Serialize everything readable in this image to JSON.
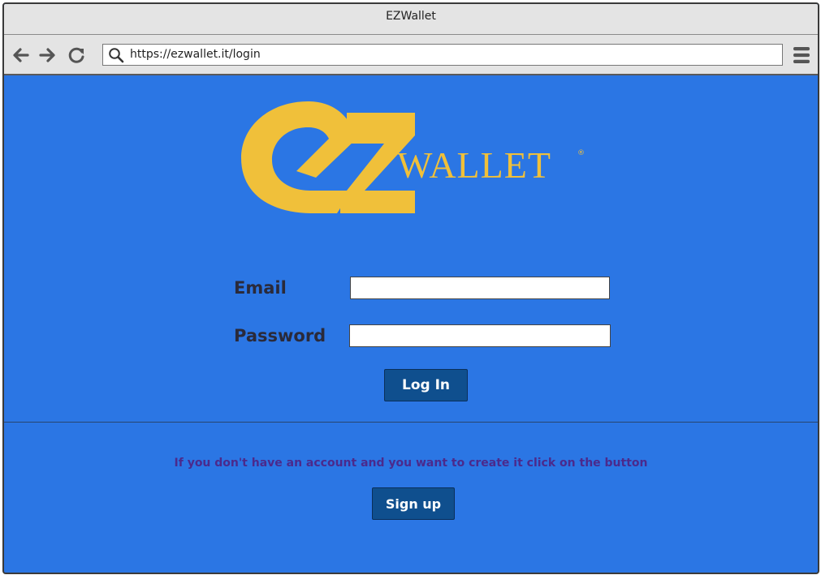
{
  "window": {
    "title": "EZWallet"
  },
  "browser": {
    "url": "https://ezwallet.it/login",
    "icons": [
      "back-arrow-icon",
      "forward-arrow-icon",
      "reload-icon",
      "search-icon",
      "hamburger-menu-icon"
    ]
  },
  "logo": {
    "text": "WALLET",
    "mark": "ez",
    "registered": "®"
  },
  "form": {
    "email_label": "Email",
    "password_label": "Password",
    "email_value": "",
    "password_value": "",
    "login_label": "Log In"
  },
  "signup": {
    "prompt": "If you don't have an account and you want to create it click on the button",
    "button_label": "Sign up"
  },
  "colors": {
    "page_background": "#2b76e4",
    "logo_yellow": "#f0c03a",
    "button": "#0f4f8e",
    "signup_text": "#4b2a8c"
  }
}
